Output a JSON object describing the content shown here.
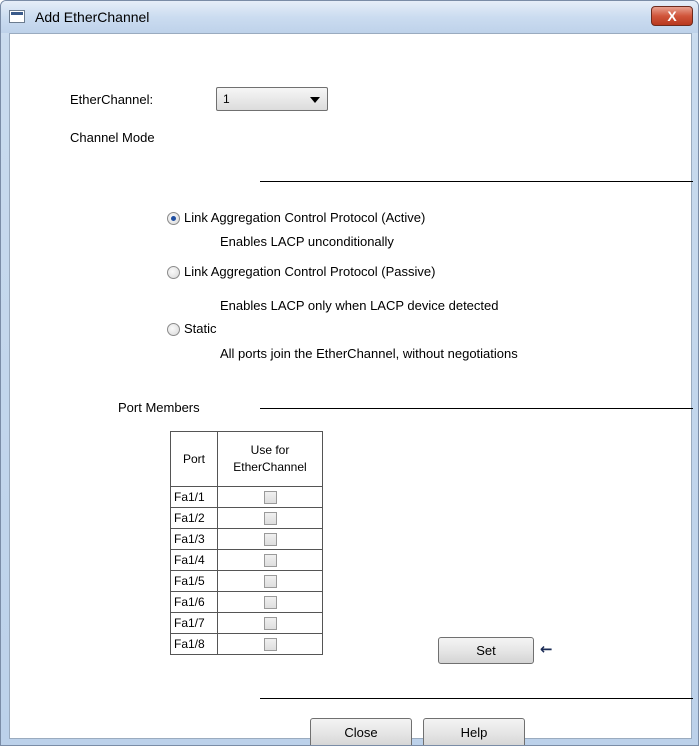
{
  "window": {
    "title": "Add EtherChannel",
    "close_glyph": "X",
    "title_icon": "window-icon"
  },
  "etherchannel": {
    "label": "EtherChannel:",
    "selected_value": "1"
  },
  "channel_mode": {
    "label": "Channel Mode",
    "options": [
      {
        "label": "Link Aggregation Control Protocol (Active)",
        "description": "Enables LACP unconditionally",
        "checked": true
      },
      {
        "label": "Link Aggregation Control Protocol (Passive)",
        "description": "Enables LACP only when LACP device detected",
        "checked": false
      },
      {
        "label": "Static",
        "description": "All ports join the EtherChannel, without negotiations",
        "checked": false
      }
    ]
  },
  "port_members": {
    "label": "Port Members",
    "columns": {
      "port": "Port",
      "use_line1": "Use for",
      "use_line2": "EtherChannel"
    },
    "rows": [
      {
        "port": "Fa1/1",
        "checked": false
      },
      {
        "port": "Fa1/2",
        "checked": false
      },
      {
        "port": "Fa1/3",
        "checked": false
      },
      {
        "port": "Fa1/4",
        "checked": false
      },
      {
        "port": "Fa1/5",
        "checked": false
      },
      {
        "port": "Fa1/6",
        "checked": false
      },
      {
        "port": "Fa1/7",
        "checked": false
      },
      {
        "port": "Fa1/8",
        "checked": false
      }
    ]
  },
  "buttons": {
    "set": "Set",
    "set_arrow": "←",
    "close": "Close",
    "help": "Help"
  },
  "colors": {
    "frame": "#bcd1ea",
    "close_button": "#c8472c",
    "radio_dot": "#1f4ea0"
  }
}
